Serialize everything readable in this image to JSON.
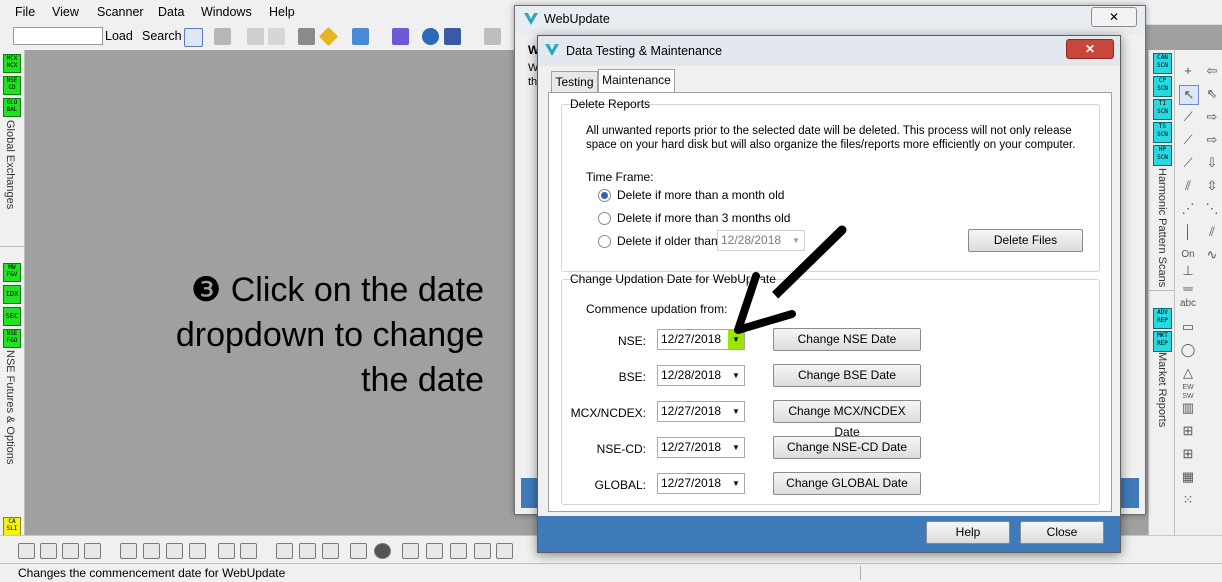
{
  "menubar": {
    "items": [
      "File",
      "View",
      "Scanner",
      "Data",
      "Windows",
      "Help"
    ]
  },
  "toolbar": {
    "search_value": "",
    "load_label": "Load",
    "search_label": "Search"
  },
  "left_panel": {
    "buttons_top": [
      "MCX NCX",
      "NSE CD",
      "GLO BAL"
    ],
    "label_top": "Global Exchanges",
    "buttons_bottom": [
      "MW F&V",
      "IDX",
      "SEC",
      "NSE F&O"
    ],
    "label_bottom": "NSE Futures & Options",
    "button_last": "CA SLI"
  },
  "instruction": {
    "text": "❸ Click on the date dropdown to change the date"
  },
  "right_panel": {
    "buttons_top": [
      "CAN SCN",
      "CP SCN",
      "TI SCN",
      "TS SCN",
      "HP SCN"
    ],
    "label_top": "Harmonic Pattern Scans",
    "buttons_bottom": [
      "ADV REP",
      "MKT REP"
    ],
    "label_bottom": "Market Reports",
    "tool_on_label": "On",
    "tool_abc_label": "abc",
    "tool_ew_label": "EW SW"
  },
  "webupdate": {
    "title": "WebUpdate",
    "close_label": "✕",
    "partial_text_1": "W",
    "partial_text_2": "W",
    "partial_text_3": "th"
  },
  "dialog": {
    "title": "Data Testing & Maintenance",
    "close_label": "✕",
    "tabs": [
      "Testing",
      "Maintenance"
    ],
    "delete_reports": {
      "title": "Delete Reports",
      "description": "All unwanted reports prior to the selected date will be deleted. This process will not only release space on your hard disk but will also organize the files/reports more efficiently on your computer.",
      "time_frame_label": "Time Frame:",
      "options": [
        "Delete if more than a month old",
        "Delete if more than 3 months old",
        "Delete if older than"
      ],
      "selected_option": "Delete if more than a month old",
      "older_than_date": "12/28/2018",
      "delete_button": "Delete Files"
    },
    "change_updation": {
      "title": "Change Updation Date for WebUpdate",
      "commence_label": "Commence updation from:",
      "rows": [
        {
          "label": "NSE:",
          "date": "12/27/2018",
          "button": "Change NSE Date"
        },
        {
          "label": "BSE:",
          "date": "12/28/2018",
          "button": "Change BSE Date"
        },
        {
          "label": "MCX/NCDEX:",
          "date": "12/27/2018",
          "button": "Change MCX/NCDEX Date"
        },
        {
          "label": "NSE-CD:",
          "date": "12/27/2018",
          "button": "Change NSE-CD Date"
        },
        {
          "label": "GLOBAL:",
          "date": "12/27/2018",
          "button": "Change GLOBAL Date"
        }
      ]
    },
    "footer": {
      "help_label": "Help",
      "close_label": "Close"
    }
  },
  "statusbar": {
    "text": "Changes the commencement date for WebUpdate"
  },
  "colors": {
    "highlight_green": "#99e600",
    "footer_blue": "#3f7bb8",
    "side_green": "#22e022",
    "side_cyan": "#2ad8e0"
  }
}
